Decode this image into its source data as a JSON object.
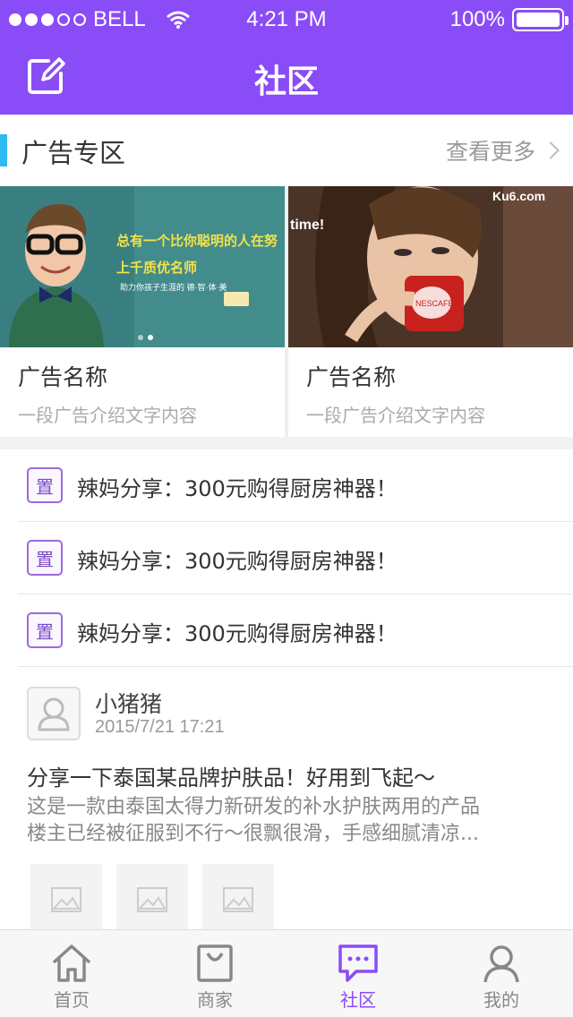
{
  "status": {
    "carrier": "BELL",
    "time": "4:21 PM",
    "battery": "100%",
    "signal_bars_filled": 3,
    "signal_bars_total": 5
  },
  "nav": {
    "title": "社区"
  },
  "ads": {
    "header_label": "广告专区",
    "more_label": "查看更多",
    "cards": [
      {
        "name": "广告名称",
        "desc": "一段广告介绍文字内容"
      },
      {
        "name": "广告名称",
        "desc": "一段广告介绍文字内容"
      }
    ],
    "image_text": {
      "one_line1": "总有一个比你聪明的人在努",
      "one_line2": "上千质优名师",
      "one_line3": "助力你孩子生涯的 德·智·体·美",
      "two_caption": "time!",
      "two_logo": "Ku6.com",
      "two_mug": "NESCAFÉ"
    }
  },
  "pinned": [
    {
      "badge": "置",
      "text": "辣妈分享：300元购得厨房神器！"
    },
    {
      "badge": "置",
      "text": "辣妈分享：300元购得厨房神器！"
    },
    {
      "badge": "置",
      "text": "辣妈分享：300元购得厨房神器！"
    }
  ],
  "post": {
    "user": "小猪猪",
    "date": "2015/7/21 17:21",
    "title": "分享一下泰国某品牌护肤品！好用到飞起～",
    "body_line1": "这是一款由泰国太得力新研发的补水护肤两用的产品",
    "body_line2": "楼主已经被征服到不行～很飘很滑，手感细腻清凉..."
  },
  "tabs": [
    {
      "label": "首页",
      "icon": "home-icon"
    },
    {
      "label": "商家",
      "icon": "shop-bag-icon"
    },
    {
      "label": "社区",
      "icon": "chat-icon"
    },
    {
      "label": "我的",
      "icon": "user-icon"
    }
  ],
  "colors": {
    "primary": "#8a4cf6",
    "accent_bar": "#2dbbf0"
  }
}
